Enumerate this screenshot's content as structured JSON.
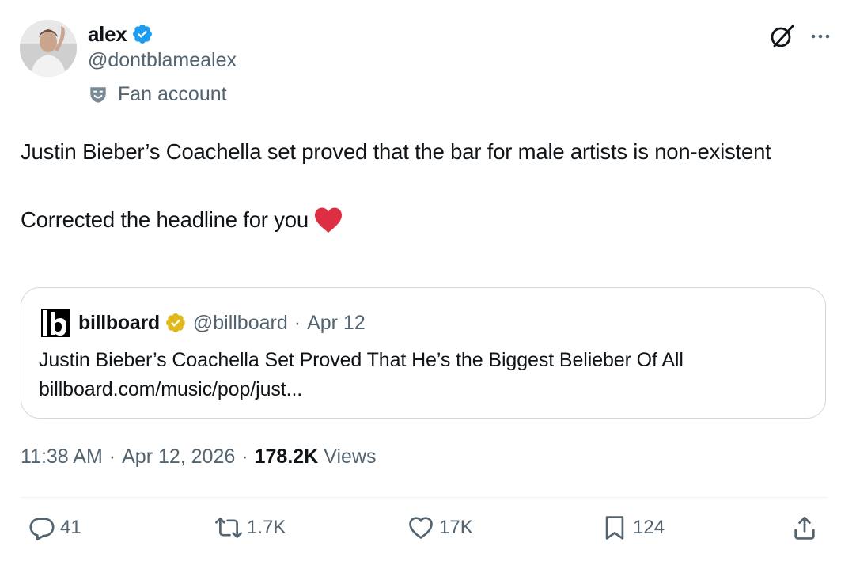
{
  "author": {
    "display_name": "alex",
    "handle": "@dontblamealex",
    "label": "Fan account",
    "verified_color": "#1d9bf0"
  },
  "tweet": {
    "text_line1": "Justin Bieber’s Coachella set proved that the bar for male artists is non-existent",
    "text_line2": "Corrected the headline for you"
  },
  "quote": {
    "name": "billboard",
    "handle": "@billboard",
    "dot": "·",
    "date": "Apr 12",
    "text": "Justin Bieber’s Coachella Set Proved That He’s the Biggest Belieber Of All",
    "link": "billboard.com/music/pop/just...",
    "badge_color": "#e2b719"
  },
  "meta": {
    "time": "11:38 AM",
    "sep1": "·",
    "date": "Apr 12, 2026",
    "sep2": "·",
    "views_count": "178.2K",
    "views_label": "Views"
  },
  "actions": {
    "replies": "41",
    "reposts": "1.7K",
    "likes": "17K",
    "bookmarks": "124"
  },
  "icons": [
    "verified-badge-icon",
    "fan-account-icon",
    "grok-icon",
    "more-icon",
    "heart-emoji-icon",
    "billboard-logo-icon",
    "gold-verified-badge-icon",
    "reply-icon",
    "repost-icon",
    "like-icon",
    "bookmark-icon",
    "share-icon"
  ],
  "colors": {
    "text": "#0f1419",
    "secondary": "#536471",
    "border": "#cfd9de",
    "heart": "#f91880"
  }
}
